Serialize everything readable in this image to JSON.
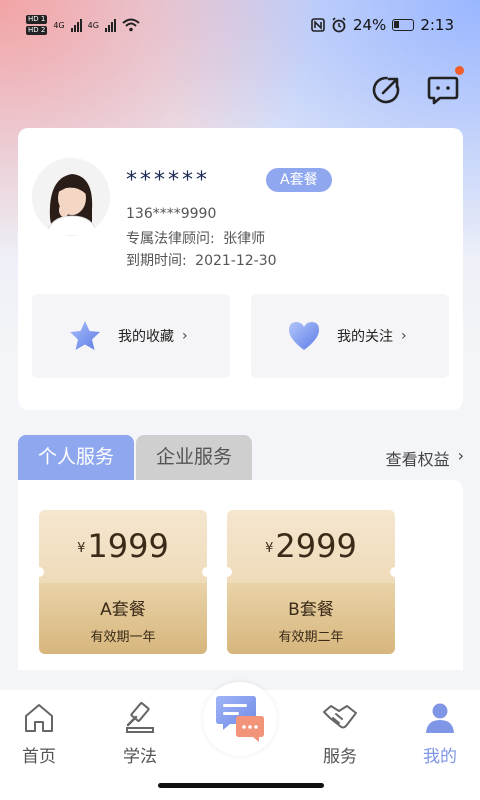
{
  "status_bar": {
    "hd1": "HD 1",
    "hd2": "HD 2",
    "net1": "4G",
    "net2": "4G",
    "battery": "24%",
    "time": "2:13"
  },
  "profile": {
    "name": "******",
    "plan_badge": "A套餐",
    "phone": "136****9990",
    "advisor_label": "专属法律顾问:",
    "advisor_name": "张律师",
    "expiry_label": "到期时间:",
    "expiry_date": "2021-12-30",
    "favorites_label": "我的收藏",
    "following_label": "我的关注",
    "chevron": "›"
  },
  "service_tabs": {
    "personal": "个人服务",
    "enterprise": "企业服务",
    "view_benefits": "查看权益",
    "chevron": "›"
  },
  "plans": [
    {
      "currency": "¥",
      "price": "1999",
      "name": "A套餐",
      "validity": "有效期一年"
    },
    {
      "currency": "¥",
      "price": "2999",
      "name": "B套餐",
      "validity": "有效期二年"
    }
  ],
  "bottom_nav": {
    "home": "首页",
    "learn": "学法",
    "services": "服务",
    "mine": "我的"
  },
  "colors": {
    "accent": "#8fa7ee",
    "nav_active": "#7f95e6",
    "notif_dot": "#f25c2a",
    "gold": "#e9d3a8"
  }
}
